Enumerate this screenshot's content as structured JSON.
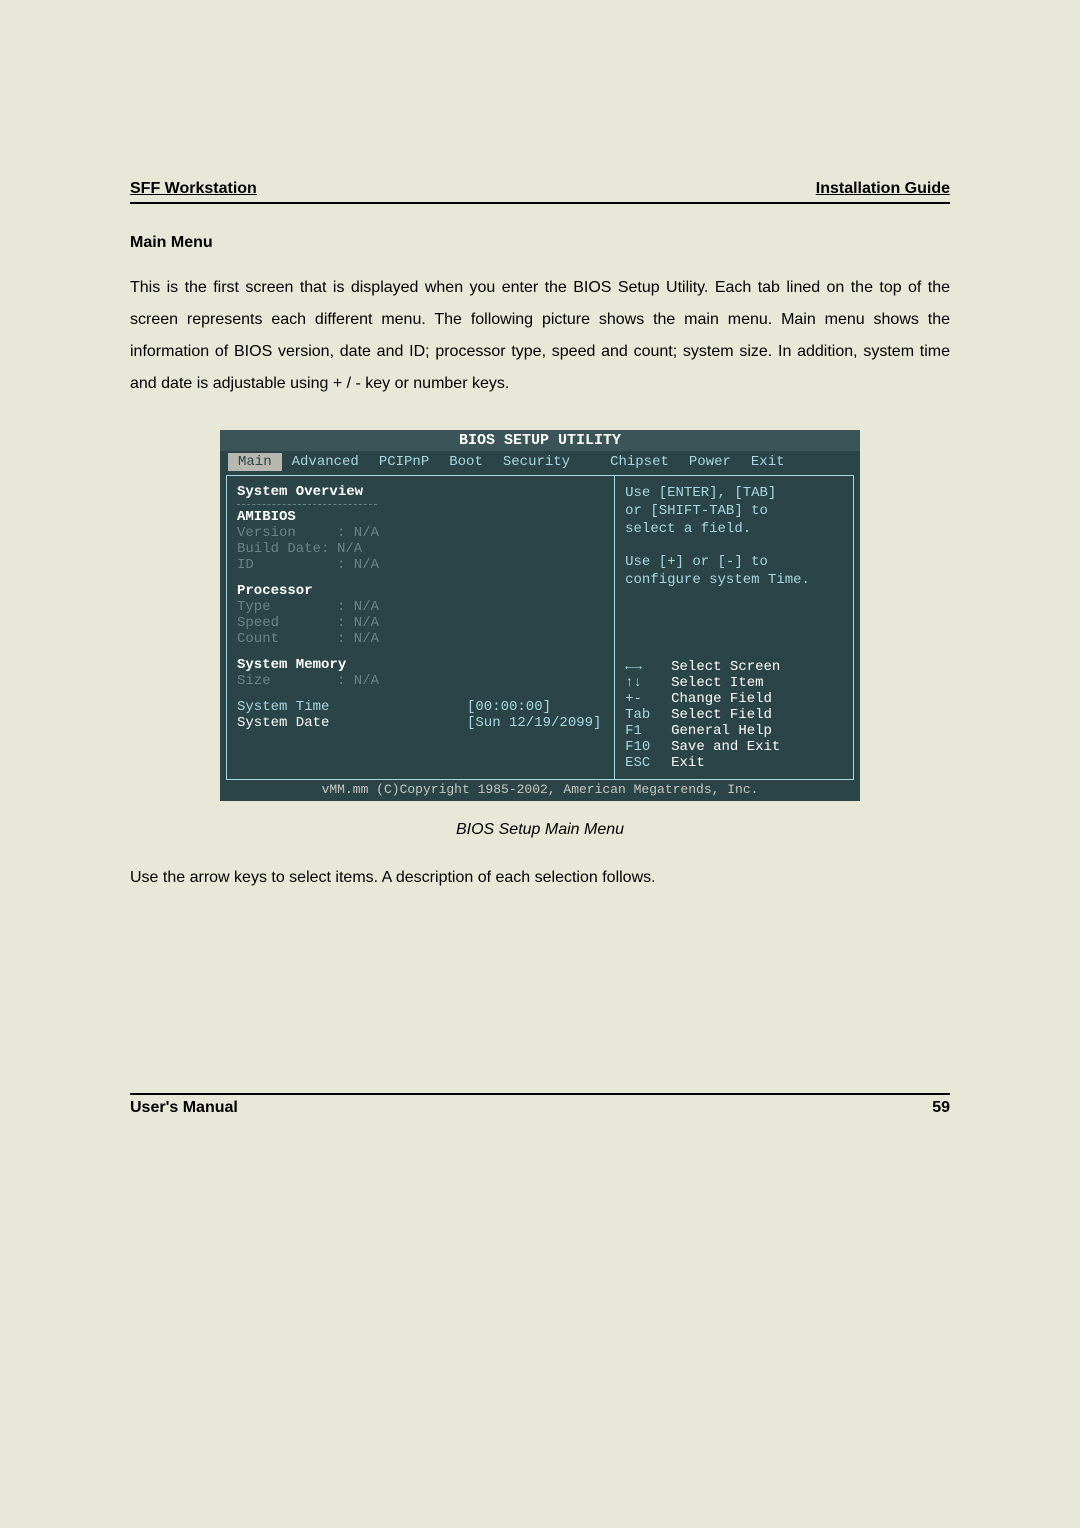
{
  "header": {
    "left": "SFF  Workstation",
    "right": "Installation  Guide"
  },
  "sectionTitle": "Main Menu",
  "bodyText": "This is the first screen that is displayed when you enter the BIOS Setup Utility. Each tab lined on the top of the screen represents each different menu. The following picture shows the main menu. Main menu shows the information of BIOS version, date and ID; processor type, speed and count; system size. In addition, system time and date is adjustable using + / - key or number keys.",
  "bios": {
    "title": "BIOS SETUP UTILITY",
    "tabs": [
      "Main",
      "Advanced",
      "PCIPnP",
      "Boot",
      "Security",
      "Chipset",
      "Power",
      "Exit"
    ],
    "overviewHeading": "System Overview",
    "amibios": {
      "label": "AMIBIOS",
      "version": {
        "label": "Version",
        "value": ": N/A"
      },
      "buildDate": {
        "label": "Build Date:",
        "value": "N/A"
      },
      "id": {
        "label": "ID",
        "value": ": N/A"
      }
    },
    "processor": {
      "label": "Processor",
      "type": {
        "label": "Type",
        "value": ": N/A"
      },
      "speed": {
        "label": "Speed",
        "value": ": N/A"
      },
      "count": {
        "label": "Count",
        "value": ": N/A"
      }
    },
    "memory": {
      "label": "System Memory",
      "size": {
        "label": "Size",
        "value": ": N/A"
      }
    },
    "systemTime": {
      "label": "System Time",
      "value": "[00:00:00]"
    },
    "systemDate": {
      "label": "System Date",
      "value": "[Sun 12/19/2099]"
    },
    "helpTop": {
      "line1": "Use [ENTER], [TAB]",
      "line2": "or [SHIFT-TAB] to",
      "line3": "select a field.",
      "line4": "Use [+] or [-] to",
      "line5": "configure system Time."
    },
    "keys": [
      {
        "k": "←→",
        "d": "Select Screen"
      },
      {
        "k": "↑↓",
        "d": "Select Item"
      },
      {
        "k": "+-",
        "d": "Change Field"
      },
      {
        "k": "Tab",
        "d": "Select Field"
      },
      {
        "k": "F1",
        "d": "General Help"
      },
      {
        "k": "F10",
        "d": "Save and Exit"
      },
      {
        "k": "ESC",
        "d": "Exit"
      }
    ],
    "footer": "vMM.mm (C)Copyright 1985-2002, American Megatrends, Inc."
  },
  "caption": "BIOS Setup Main Menu",
  "afterText": "Use the arrow keys to select items. A description of each selection follows.",
  "footer": {
    "left": "User's  Manual",
    "right": "59"
  }
}
